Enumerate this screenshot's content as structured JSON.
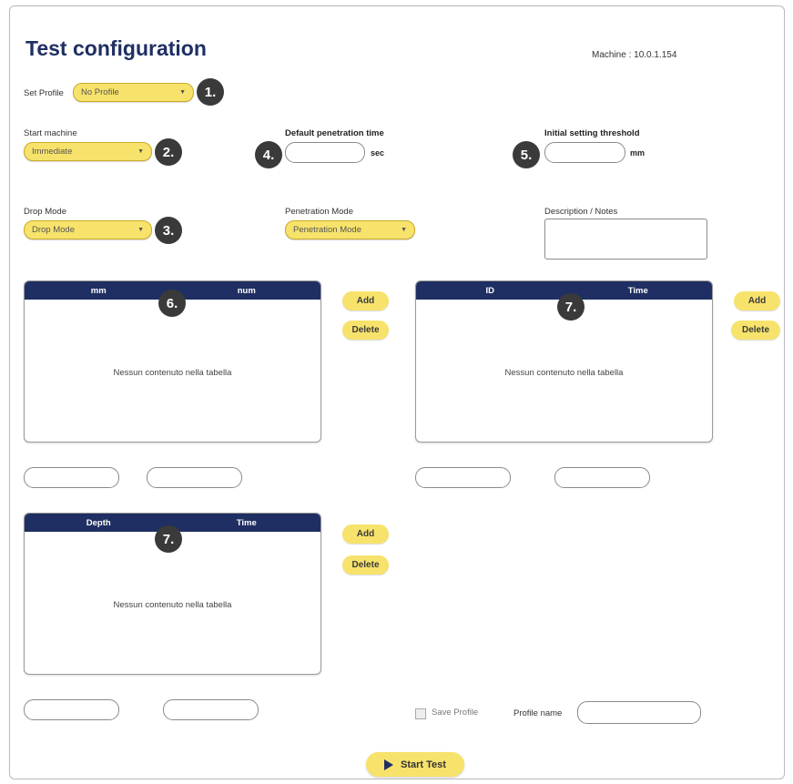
{
  "header": {
    "title": "Test configuration",
    "machine": "Machine : 10.0.1.154"
  },
  "badges": [
    "1.",
    "2.",
    "3.",
    "4.",
    "5.",
    "6.",
    "7.",
    "7."
  ],
  "profile": {
    "label": "Set Profile",
    "value": "No Profile"
  },
  "start_machine": {
    "label": "Start machine",
    "value": "Immediate"
  },
  "drop_mode": {
    "label": "Drop Mode",
    "value": "Drop Mode"
  },
  "penetration_time": {
    "label": "Default penetration time",
    "value": "",
    "unit": "sec"
  },
  "penetration_mode": {
    "label": "Penetration Mode",
    "value": "Penetration Mode"
  },
  "threshold": {
    "label": "Initial setting threshold",
    "value": "",
    "unit": "mm"
  },
  "notes": {
    "label": "Description / Notes",
    "value": ""
  },
  "tables": [
    {
      "columns": [
        "mm",
        "num"
      ],
      "empty_text": "Nessun contenuto nella tabella",
      "add_label": "Add",
      "delete_label": "Delete"
    },
    {
      "columns": [
        "ID",
        "Time"
      ],
      "empty_text": "Nessun contenuto nella tabella",
      "add_label": "Add",
      "delete_label": "Delete"
    },
    {
      "columns": [
        "Depth",
        "Time"
      ],
      "empty_text": "Nessun contenuto nella tabella",
      "add_label": "Add",
      "delete_label": "Delete"
    }
  ],
  "footer": {
    "save_profile_label": "Save Profile",
    "save_profile_checked": false,
    "profile_name_label": "Profile name",
    "profile_name_value": "",
    "start_label": "Start Test"
  },
  "colors": {
    "accent": "#f7e36b",
    "header": "#1f2f63",
    "badge": "#3a3a3a"
  },
  "icons": {
    "dropdown": "chevron-down-icon",
    "start": "play-icon"
  }
}
